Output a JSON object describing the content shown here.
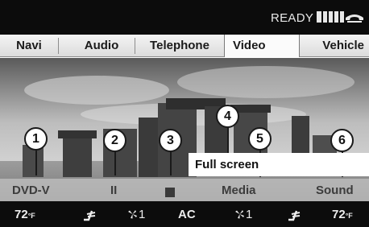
{
  "status": {
    "text": "READY"
  },
  "menu": [
    {
      "label": "Navi"
    },
    {
      "label": "Audio"
    },
    {
      "label": "Telephone"
    },
    {
      "label": "Video",
      "active": true
    },
    {
      "label": "Vehicle"
    }
  ],
  "video": {
    "popup_text": "Full screen",
    "callouts": [
      "1",
      "2",
      "3",
      "4",
      "5",
      "6"
    ],
    "controls": {
      "source": "DVD-V",
      "pause": "II",
      "media": "Media",
      "sound": "Sound"
    }
  },
  "climate": {
    "left_temp": "72",
    "left_unit": "°F",
    "left_fan": "1",
    "ac": "AC",
    "right_fan": "1",
    "right_temp": "72",
    "right_unit": "°F"
  }
}
